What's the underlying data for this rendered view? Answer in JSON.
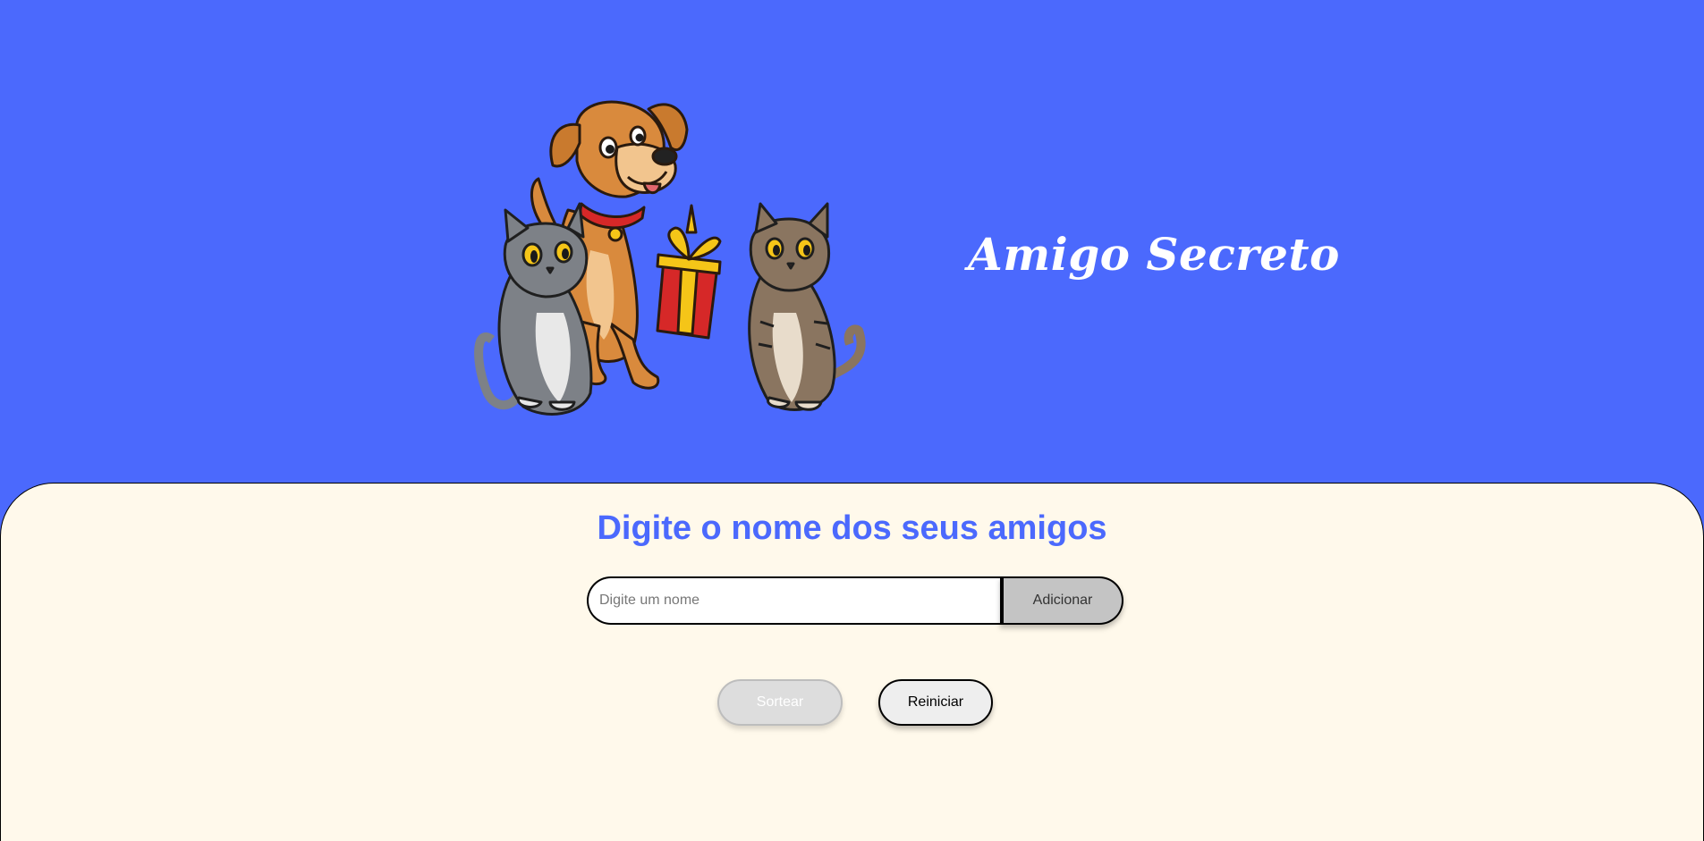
{
  "header": {
    "title": "Amigo Secreto",
    "illustration": {
      "name": "dog-and-cats-with-gift-illustration",
      "icons": [
        "dog-icon",
        "gray-cat-icon",
        "tabby-cat-icon",
        "gift-box-icon"
      ]
    }
  },
  "main": {
    "subtitle": "Digite o nome dos seus amigos",
    "name_input": {
      "placeholder": "Digite um nome",
      "value": ""
    },
    "add_button_label": "Adicionar",
    "draw_button_label": "Sortear",
    "reset_button_label": "Reiniciar"
  },
  "colors": {
    "header_background": "#4B69FD",
    "main_background": "#FFF9EB",
    "accent": "#4B69FD",
    "add_button": "#C4C4C4",
    "disabled_button": "#DDDDDD"
  }
}
